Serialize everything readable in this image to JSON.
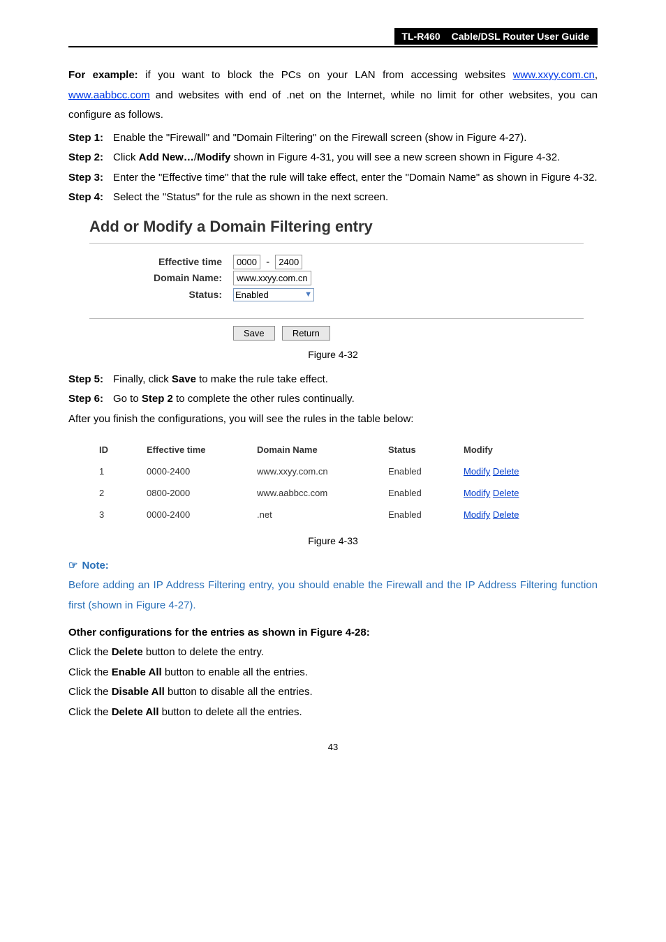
{
  "header": {
    "model": "TL-R460",
    "title": "Cable/DSL  Router  User  Guide"
  },
  "intro": {
    "lead": "For example:",
    "body1": " if you want to block the PCs on your LAN from accessing websites ",
    "link1": "www.xxyy.com.cn",
    "sep": ", ",
    "link2": "www.aabbcc.com",
    "body2": " and websites with end of .net on the Internet, while no limit for other websites, you can configure as follows."
  },
  "steps": [
    {
      "label": "Step 1:",
      "pre": "Enable the \"Firewall\" and \"Domain Filtering\" on the Firewall screen (show in Figure 4-27)."
    },
    {
      "label": "Step 2:",
      "pre": "Click ",
      "b1": "Add New…",
      "mid1": "/",
      "b2": "Modify",
      "post": " shown in Figure 4-31, you will see a new screen shown in Figure 4-32."
    },
    {
      "label": "Step 3:",
      "pre": "Enter the \"Effective time\" that the rule will take effect, enter the \"Domain Name\" as shown in Figure 4-32."
    },
    {
      "label": "Step 4:",
      "pre": "Select the \"Status\" for the rule as shown in the next screen."
    }
  ],
  "figform": {
    "title": "Add or Modify a Domain Filtering entry",
    "labels": {
      "eff": "Effective time",
      "dom": "Domain Name:",
      "stat": "Status:"
    },
    "values": {
      "t1": "0000",
      "t2": "2400",
      "domain": "www.xxyy.com.cn",
      "status": "Enabled"
    },
    "buttons": {
      "save": "Save",
      "ret": "Return"
    }
  },
  "caption32": "Figure 4-32",
  "steps2": [
    {
      "label": "Step 5:",
      "pre": "Finally, click ",
      "b1": "Save",
      "post": " to make the rule take effect."
    },
    {
      "label": "Step 6:",
      "pre": "Go to ",
      "b1": "Step 2",
      "post": " to complete the other rules continually."
    }
  ],
  "afterline": "After you finish the configurations, you will see the rules in the table below:",
  "table": {
    "headers": {
      "id": "ID",
      "eff": "Effective time",
      "dom": "Domain Name",
      "stat": "Status",
      "mod": "Modify"
    },
    "rows": [
      {
        "id": "1",
        "eff": "0000-2400",
        "dom": "www.xxyy.com.cn",
        "stat": "Enabled",
        "m": "Modify",
        "d": "Delete"
      },
      {
        "id": "2",
        "eff": "0800-2000",
        "dom": "www.aabbcc.com",
        "stat": "Enabled",
        "m": "Modify",
        "d": "Delete"
      },
      {
        "id": "3",
        "eff": "0000-2400",
        "dom": ".net",
        "stat": "Enabled",
        "m": "Modify",
        "d": "Delete"
      }
    ]
  },
  "caption33": "Figure 4-33",
  "note": {
    "title": "Note:",
    "body": "Before adding an IP Address Filtering entry, you should enable the Firewall and the IP Address Filtering function first (shown in Figure 4-27)."
  },
  "other": {
    "title": "Other configurations for the entries as shown in Figure 4-28:",
    "lines": [
      {
        "pre": "Click the ",
        "b": "Delete",
        "post": " button to delete the entry."
      },
      {
        "pre": "Click the ",
        "b": "Enable All",
        "post": " button to enable all the entries."
      },
      {
        "pre": "Click the ",
        "b": "Disable All",
        "post": " button to disable all the entries."
      },
      {
        "pre": "Click the ",
        "b": "Delete All",
        "post": " button to delete all the entries."
      }
    ]
  },
  "pagenum": "43"
}
